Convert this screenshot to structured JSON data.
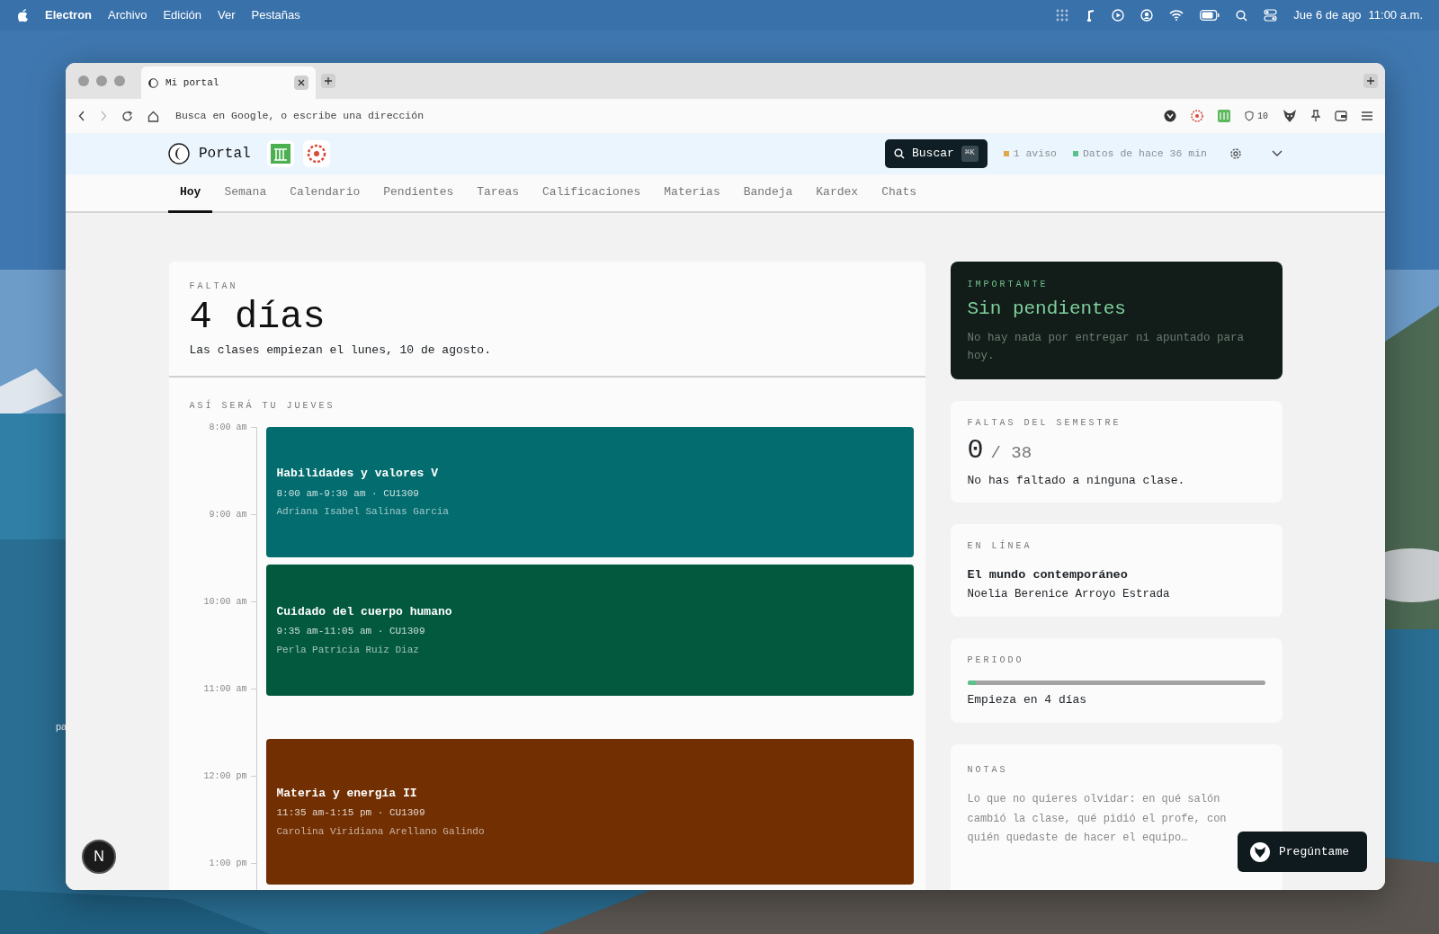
{
  "menubar": {
    "app": "Electron",
    "menus": [
      "Archivo",
      "Edición",
      "Ver",
      "Pestañas"
    ],
    "clock_date": "Jue 6 de ago",
    "clock_time": "11:00 a.m."
  },
  "desktop_label": "pa",
  "browser": {
    "tab_title": "Mi portal",
    "address_placeholder": "Busca en Google, o escribe una dirección",
    "shield_count": "10"
  },
  "portal": {
    "brand": "Portal",
    "search_label": "Buscar",
    "search_shortcut": "⌘K",
    "alerts": [
      {
        "text": "1 aviso",
        "color": "#e0a84a"
      },
      {
        "text": "Datos de hace 36 min",
        "color": "#5cc08a"
      }
    ]
  },
  "nav": [
    {
      "label": "Hoy",
      "selected": true
    },
    {
      "label": "Semana",
      "selected": false
    },
    {
      "label": "Calendario",
      "selected": false
    },
    {
      "label": "Pendientes",
      "selected": false
    },
    {
      "label": "Tareas",
      "selected": false
    },
    {
      "label": "Calificaciones",
      "selected": false
    },
    {
      "label": "Materias",
      "selected": false
    },
    {
      "label": "Bandeja",
      "selected": false
    },
    {
      "label": "Kardex",
      "selected": false
    },
    {
      "label": "Chats",
      "selected": false
    }
  ],
  "countdown": {
    "label": "FALTAN",
    "value": "4 días",
    "note": "Las clases empiezan el lunes, 10 de agosto."
  },
  "schedule": {
    "title": "ASÍ SERÁ TU JUEVES",
    "hours": [
      "8:00 am",
      "9:00 am",
      "10:00 am",
      "11:00 am",
      "12:00 pm",
      "1:00 pm"
    ],
    "events": [
      {
        "title": "Habilidades y valores V",
        "details": "8:00 am-9:30 am · CU1309",
        "teacher": "Adriana Isabel Salinas Garcia",
        "color": "#036c6e"
      },
      {
        "title": "Cuidado del cuerpo humano",
        "details": "9:35 am-11:05 am · CU1309",
        "teacher": "Perla Patricia Ruiz Diaz",
        "color": "#02593e"
      },
      {
        "title": "Materia y energía II",
        "details": "11:35 am-1:15 pm · CU1309",
        "teacher": "Carolina Viridiana Arellano Galindo",
        "color": "#722f02"
      }
    ]
  },
  "important": {
    "label": "IMPORTANTE",
    "title": "Sin pendientes",
    "note": "No hay nada por entregar ni apuntado para hoy."
  },
  "absences": {
    "label": "FALTAS DEL SEMESTRE",
    "count": "0",
    "total": "/ 38",
    "note": "No has faltado a ninguna clase."
  },
  "online": {
    "label": "EN LÍNEA",
    "course": "El mundo contemporáneo",
    "teacher": "Noelia Berenice Arroyo Estrada"
  },
  "period": {
    "label": "PERIODO",
    "level": 0.03,
    "note": "Empieza en 4 días"
  },
  "notes": {
    "label": "NOTAS",
    "placeholder": "Lo que no quieres olvidar: en qué salón cambió la clase, qué pidió el profe, con quién quedaste de hacer el equipo…"
  },
  "assistant": {
    "label": "Pregúntame"
  },
  "dev_badge": "N"
}
